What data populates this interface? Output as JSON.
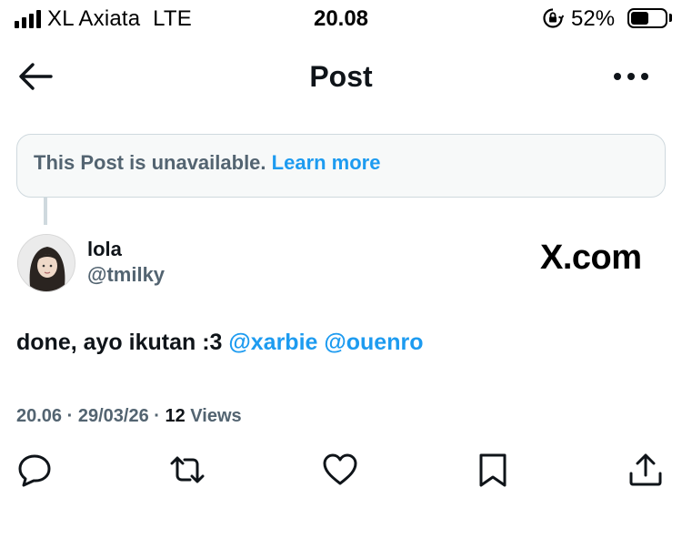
{
  "status_bar": {
    "carrier": "XL Axiata",
    "network": "LTE",
    "time": "20.08",
    "battery_percent": "52%",
    "battery_level": 0.52,
    "icons": [
      "signal-bars-icon",
      "orientation-lock-icon",
      "battery-icon"
    ]
  },
  "header": {
    "title": "Post",
    "icons": [
      "back-arrow-icon",
      "more-dots-icon"
    ]
  },
  "notice": {
    "text": "This Post is unavailable.",
    "link": "Learn more"
  },
  "author": {
    "name": "lola",
    "handle": "@tmilky"
  },
  "watermark": "X.com",
  "post": {
    "text": "done, ayo ikutan :3",
    "mentions": [
      "@xarbie",
      "@ouenro"
    ]
  },
  "meta": {
    "time": "20.06",
    "separator": " · ",
    "date": "29/03/26",
    "views_count": "12",
    "views_label": "Views"
  },
  "actions": [
    "reply-icon",
    "repost-icon",
    "like-icon",
    "bookmark-icon",
    "share-icon"
  ],
  "colors": {
    "accent": "#1d9bf0",
    "secondary_text": "#536471",
    "primary_text": "#0f1419",
    "border": "#cfd9de"
  }
}
